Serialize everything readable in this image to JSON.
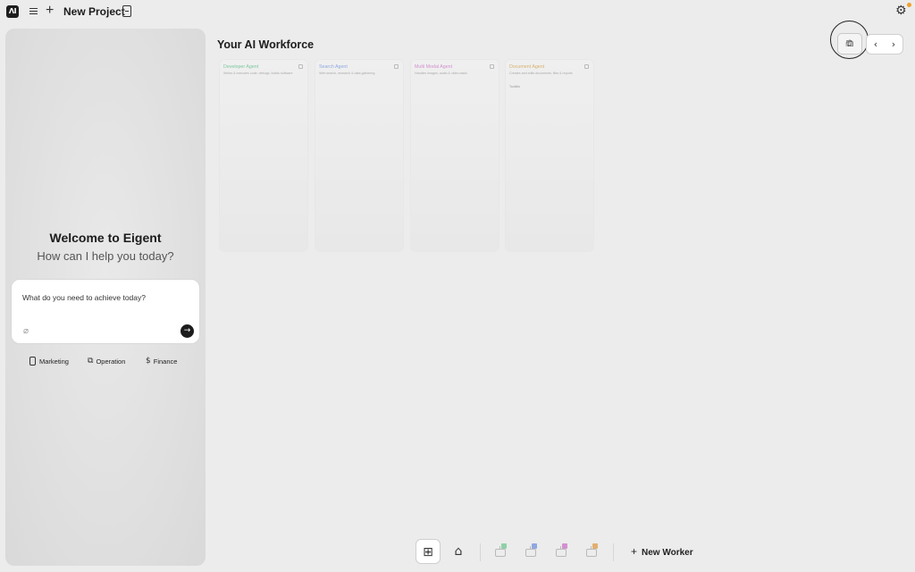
{
  "topbar": {
    "logo_text": "ΛI",
    "project_title": "New Project",
    "menu_icon": "hamburger-icon",
    "new_icon": "plus-icon",
    "file_icon": "file-icon",
    "settings_icon": "gear-icon"
  },
  "left_panel": {
    "welcome_title": "Welcome to Eigent",
    "welcome_subtitle": "How can I help you today?",
    "input_placeholder": "What do you need to achieve today?",
    "quick_actions": [
      {
        "label": "Marketing",
        "icon": "phone-icon"
      },
      {
        "label": "Operation",
        "icon": "workflow-icon"
      },
      {
        "label": "Finance",
        "icon": "dollar-icon"
      }
    ]
  },
  "main": {
    "title": "Your AI Workforce",
    "agents": [
      {
        "name": "Developer Agent",
        "color": "#7ec8a0",
        "desc": "Writes & executes code, debugs, builds software",
        "extra": ""
      },
      {
        "name": "Search Agent",
        "color": "#8fa8e0",
        "desc": "Web search, research & data gathering",
        "extra": ""
      },
      {
        "name": "Multi Modal Agent",
        "color": "#d48fd0",
        "desc": "Handles images, audio & video tasks",
        "extra": ""
      },
      {
        "name": "Document Agent",
        "color": "#d8b070",
        "desc": "Creates and edits documents, files & reports",
        "extra": "Toolkits"
      }
    ]
  },
  "bottom_bar": {
    "new_worker_label": "New Worker",
    "workers": [
      {
        "badge_color": "#8fd0a8"
      },
      {
        "badge_color": "#8fa8e0"
      },
      {
        "badge_color": "#d48fd0"
      },
      {
        "badge_color": "#e0b070"
      }
    ]
  }
}
